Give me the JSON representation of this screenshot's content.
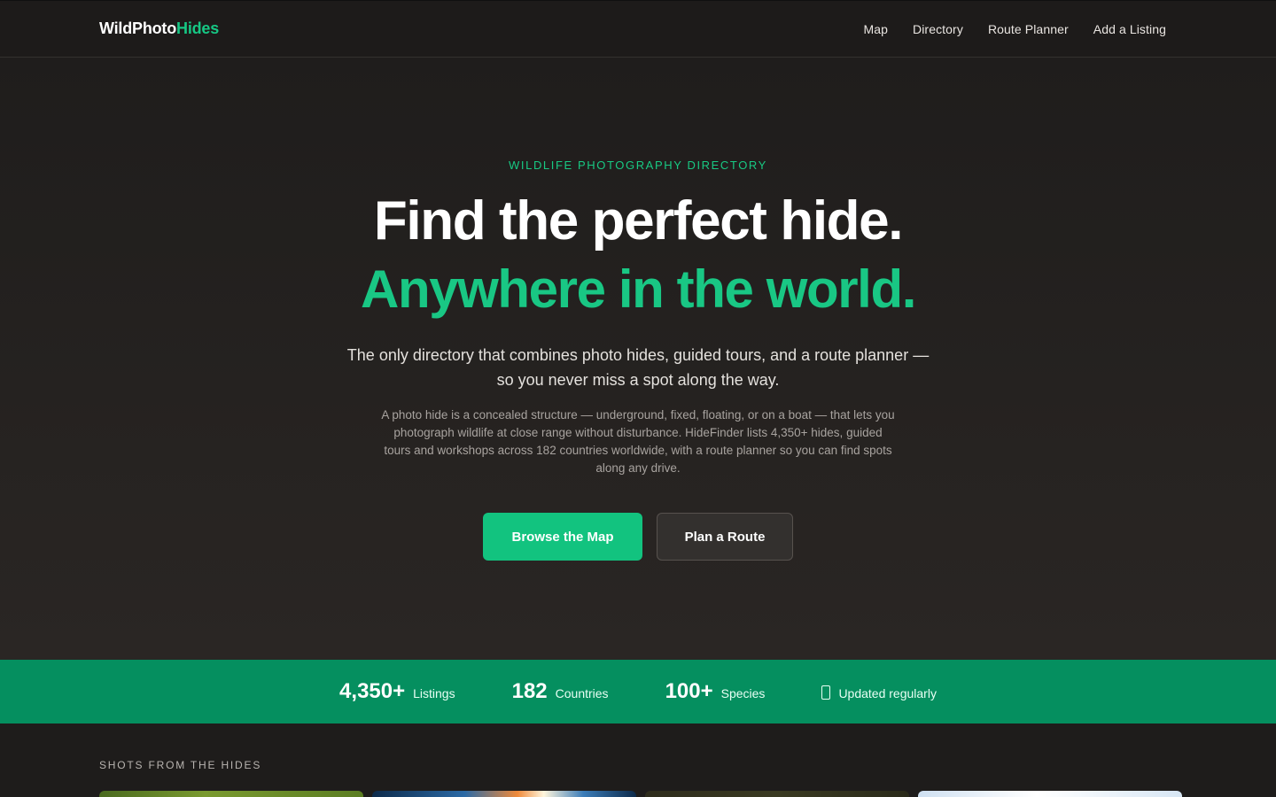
{
  "nav": {
    "logo_primary": "WildPhoto",
    "logo_accent": "Hides",
    "links": [
      "Map",
      "Directory",
      "Route Planner",
      "Add a Listing"
    ]
  },
  "hero": {
    "eyebrow": "WILDLIFE PHOTOGRAPHY DIRECTORY",
    "headline_1": "Find the perfect hide.",
    "headline_2": "Anywhere in the world.",
    "subheadline": "The only directory that combines photo hides, guided tours, and a route planner — so you never miss a spot along the way.",
    "description": "A photo hide is a concealed structure — underground, fixed, floating, or on a boat — that lets you photograph wildlife at close range without disturbance. HideFinder lists 4,350+ hides, guided tours and workshops across 182 countries worldwide, with a route planner so you can find spots along any drive.",
    "primary_cta": "Browse the Map",
    "secondary_cta": "Plan a Route"
  },
  "stats": {
    "items": [
      {
        "value": "4,350+",
        "label": "Listings"
      },
      {
        "value": "182",
        "label": "Countries"
      },
      {
        "value": "100+",
        "label": "Species"
      }
    ],
    "updated": {
      "icon": "refresh-icon",
      "label": "Updated regularly"
    }
  },
  "section": {
    "title": "SHOTS FROM THE HIDES"
  },
  "colors": {
    "accent": "#16c784",
    "stats_bar": "#058f5f",
    "background": "#1f1d1c"
  }
}
